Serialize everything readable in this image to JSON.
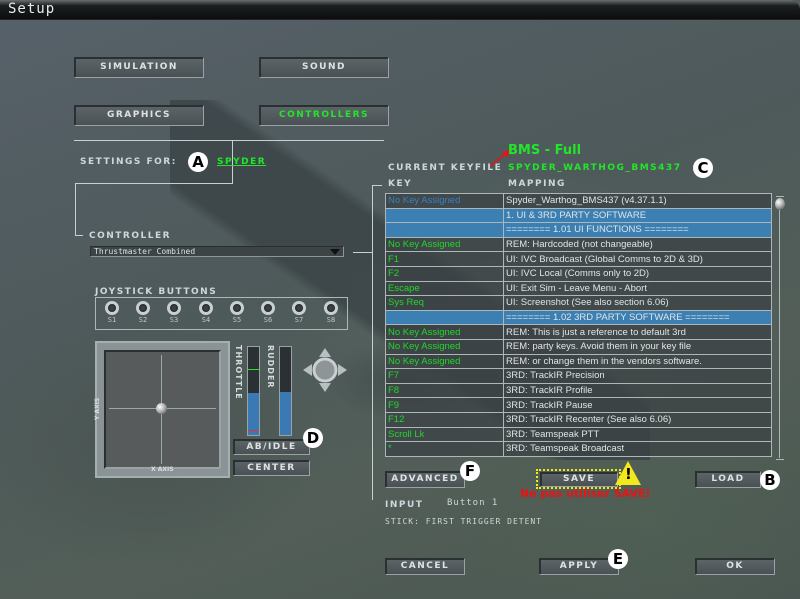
{
  "window": {
    "title": "Setup"
  },
  "tabs": [
    {
      "label": "Simulation",
      "active": false
    },
    {
      "label": "Sound",
      "active": false
    },
    {
      "label": "Graphics",
      "active": false
    },
    {
      "label": "Controllers",
      "active": true
    }
  ],
  "settings": {
    "label": "Settings For:",
    "profile": "Spyder"
  },
  "controller": {
    "label": "Controller",
    "selected": "Thrustmaster Combined"
  },
  "joystick_buttons": {
    "label": "Joystick Buttons",
    "buttons": [
      "S1",
      "S2",
      "S3",
      "S4",
      "S5",
      "S6",
      "S7",
      "S8"
    ]
  },
  "axes": {
    "x_label": "X AXIS",
    "y_label": "Y AXIS",
    "throttle_label": "THROTTLE",
    "rudder_label": "RUDDER",
    "throttle_fill": 0.48,
    "rudder_fill": 0.49,
    "ab_button": "AB/Idle",
    "center_button": "Center"
  },
  "keyfile": {
    "annotation": "BMS - Full",
    "label": "Current Keyfile",
    "value": "Spyder_Warthog_BMS437"
  },
  "table": {
    "col_key": "Key",
    "col_mapping": "Mapping",
    "rows": [
      {
        "key": "No Key Assigned",
        "mapping": "Spyder_Warthog_BMS437 (v4.37.1.1)",
        "type": "first"
      },
      {
        "key": "",
        "mapping": "1. UI & 3RD PARTY SOFTWARE",
        "type": "hdr"
      },
      {
        "key": "",
        "mapping": "======== 1.01     UI FUNCTIONS ========",
        "type": "hdr"
      },
      {
        "key": "No Key Assigned",
        "mapping": "REM: Hardcoded (not changeable)",
        "type": "row"
      },
      {
        "key": "F1",
        "mapping": "UI: IVC Broadcast (Global Comms to 2D & 3D)",
        "type": "row"
      },
      {
        "key": "F2",
        "mapping": "UI: IVC Local (Comms only to 2D)",
        "type": "row"
      },
      {
        "key": "Escape",
        "mapping": "UI: Exit Sim - Leave Menu - Abort",
        "type": "row"
      },
      {
        "key": "Sys Req",
        "mapping": "UI: Screenshot (See also section 6.06)",
        "type": "row"
      },
      {
        "key": "",
        "mapping": "======== 1.02     3RD PARTY SOFTWARE ========",
        "type": "hdr"
      },
      {
        "key": "No Key Assigned",
        "mapping": "REM: This is just a reference to default 3rd",
        "type": "row"
      },
      {
        "key": "No Key Assigned",
        "mapping": "REM: party keys. Avoid them in your key file",
        "type": "row"
      },
      {
        "key": "No Key Assigned",
        "mapping": "REM: or change them in the vendors software.",
        "type": "row"
      },
      {
        "key": "F7",
        "mapping": "3RD: TrackIR Precision",
        "type": "row"
      },
      {
        "key": "F8",
        "mapping": "3RD: TrackIR Profile",
        "type": "row"
      },
      {
        "key": "F9",
        "mapping": "3RD: TrackIR Pause",
        "type": "row"
      },
      {
        "key": "F12",
        "mapping": "3RD: TrackIR Recenter (See also 6.06)",
        "type": "row"
      },
      {
        "key": "Scroll Lk",
        "mapping": "3RD: Teamspeak PTT",
        "type": "row"
      },
      {
        "key": "*",
        "mapping": "3RD: Teamspeak Broadcast",
        "type": "row"
      }
    ]
  },
  "actions": {
    "advanced": "Advanced",
    "save": "Save",
    "load": "Load",
    "save_warning": "Ne pas utiliser SAVE!"
  },
  "input": {
    "label": "Input",
    "value": "Button 1",
    "description": "STICK: FIRST TRIGGER DETENT"
  },
  "footer": {
    "cancel": "Cancel",
    "apply": "Apply",
    "ok": "Ok"
  },
  "badges": {
    "a": "A",
    "b": "B",
    "c": "C",
    "d": "D",
    "e": "E",
    "f": "F"
  },
  "colors": {
    "accent_green": "#22e62a",
    "highlight_blue": "#3c7fb3",
    "warning_yellow": "#f2e81c",
    "warning_red": "#ee1111"
  }
}
